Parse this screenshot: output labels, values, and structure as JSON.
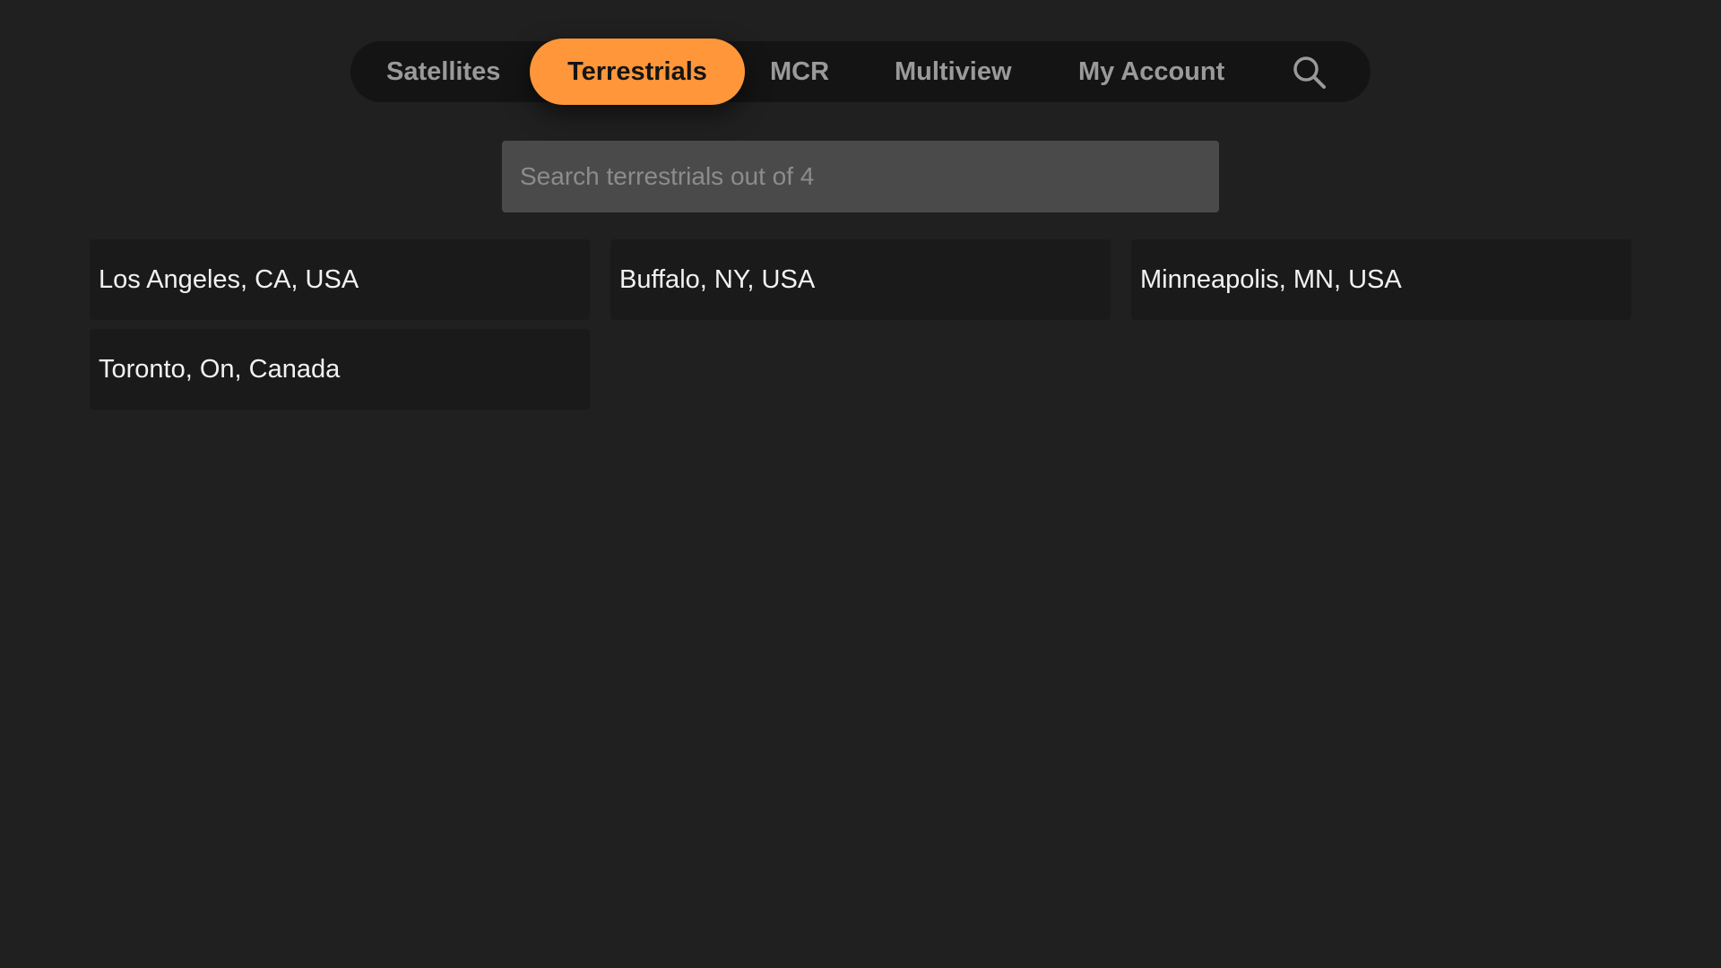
{
  "nav": {
    "items": [
      {
        "label": "Satellites",
        "active": false
      },
      {
        "label": "Terrestrials",
        "active": true
      },
      {
        "label": "MCR",
        "active": false
      },
      {
        "label": "Multiview",
        "active": false
      },
      {
        "label": "My Account",
        "active": false
      }
    ],
    "search_icon": "search-icon",
    "accent_color": "#ff963a"
  },
  "search": {
    "placeholder": "Search terrestrials out of 4",
    "value": ""
  },
  "locations": [
    {
      "label": "Los Angeles, CA, USA"
    },
    {
      "label": "Buffalo, NY, USA"
    },
    {
      "label": "Minneapolis, MN, USA"
    },
    {
      "label": "Toronto, On, Canada"
    }
  ]
}
